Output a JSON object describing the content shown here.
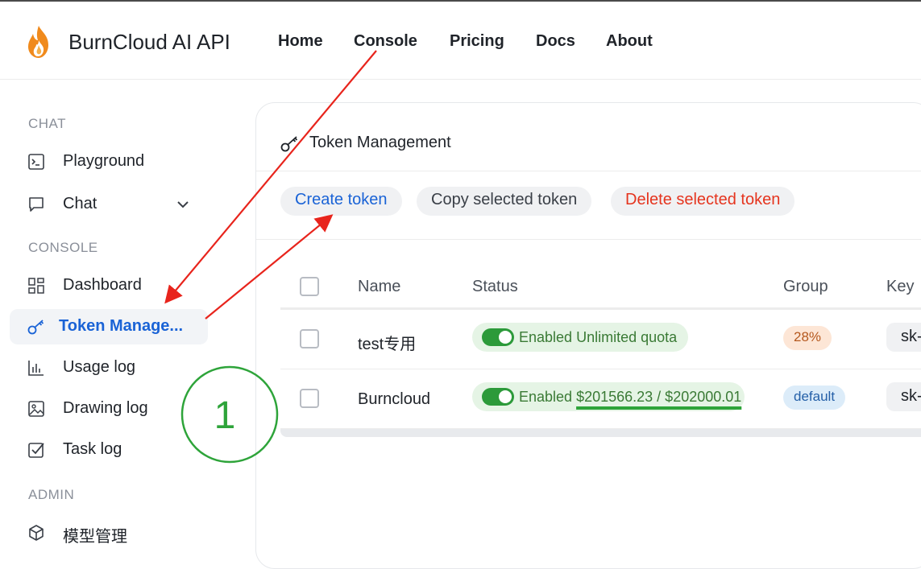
{
  "header": {
    "brand": "BurnCloud AI API",
    "nav": [
      "Home",
      "Console",
      "Pricing",
      "Docs",
      "About"
    ]
  },
  "sidebar": {
    "sections": {
      "chat": "CHAT",
      "console": "CONSOLE",
      "admin": "ADMIN"
    },
    "items": [
      {
        "label": "Playground",
        "icon": "terminal-icon"
      },
      {
        "label": "Chat",
        "icon": "chat-bubble-icon"
      },
      {
        "label": "Dashboard",
        "icon": "dashboard-grid-icon"
      },
      {
        "label": "Token Manage...",
        "icon": "key-icon"
      },
      {
        "label": "Usage log",
        "icon": "bar-chart-icon"
      },
      {
        "label": "Drawing log",
        "icon": "image-icon"
      },
      {
        "label": "Task log",
        "icon": "checkbox-icon"
      },
      {
        "label": "模型管理",
        "icon": "cube-icon"
      }
    ]
  },
  "panel": {
    "title": "Token Management",
    "buttons": {
      "create": "Create token",
      "copy": "Copy selected token",
      "delete": "Delete selected token"
    },
    "columns": [
      "Name",
      "Status",
      "Group",
      "Key"
    ],
    "rows": [
      {
        "name": "test专用",
        "status": "Enabled",
        "quota": "Unlimited quota",
        "group": "28%",
        "key": "sk-"
      },
      {
        "name": "Burncloud",
        "status": "Enabled",
        "quota": "$201566.23 / $202000.01",
        "group": "default",
        "key": "sk-"
      }
    ]
  },
  "annotation": {
    "marker": "1"
  },
  "colors": {
    "accent_blue": "#1a63d6",
    "danger_red": "#e5341e",
    "enabled_green": "#2c9a3a",
    "annotation_red": "#e8241c",
    "annotation_green": "#2ea43a",
    "tag_orange_bg": "#fde6d6",
    "tag_blue_bg": "#dcecf9"
  }
}
